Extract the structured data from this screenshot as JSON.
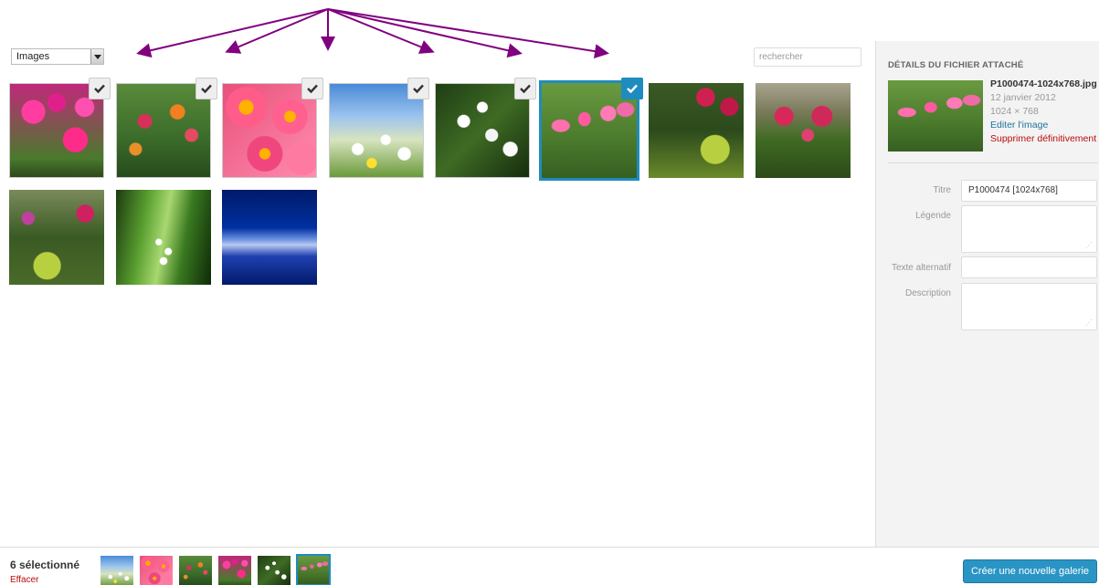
{
  "filter": {
    "selected": "Images"
  },
  "search": {
    "placeholder": "rechercher"
  },
  "grid": {
    "items": [
      {
        "image": "magenta-ranunculus-flowers",
        "selected": true,
        "current": false
      },
      {
        "image": "red-orange-garden-flowers",
        "selected": true,
        "current": false
      },
      {
        "image": "pink-gerbera-flowers",
        "selected": true,
        "current": false
      },
      {
        "image": "daisies-blue-sky",
        "selected": true,
        "current": false
      },
      {
        "image": "white-viburnum-flowers",
        "selected": true,
        "current": false
      },
      {
        "image": "pink-bleeding-heart-flowers",
        "selected": true,
        "current": true
      },
      {
        "image": "red-peony-shrub",
        "selected": false,
        "current": false
      },
      {
        "image": "red-peonies-stone-wall",
        "selected": false,
        "current": false
      },
      {
        "image": "garden-border-flowers",
        "selected": false,
        "current": false
      },
      {
        "image": "lily-of-the-valley",
        "selected": false,
        "current": false
      },
      {
        "image": "blue-hyacinth-field",
        "selected": false,
        "current": false
      }
    ]
  },
  "details": {
    "heading": "DÉTAILS DU FICHIER ATTACHÉ",
    "filename": "P1000474-1024x768.jpg",
    "date": "12 janvier 2012",
    "dimensions": "1024 × 768",
    "edit_link": "Editer l'image",
    "delete_link": "Supprimer définitivement",
    "fields": {
      "title_label": "Titre",
      "title_value": "P1000474 [1024x768]",
      "caption_label": "Légende",
      "caption_value": "",
      "alt_label": "Texte alternatif",
      "alt_value": "",
      "description_label": "Description",
      "description_value": ""
    }
  },
  "selection": {
    "count_text": "6 sélectionné",
    "clear_link": "Effacer",
    "thumbnails": [
      "daisies-blue-sky",
      "pink-gerbera-flowers",
      "red-orange-garden-flowers",
      "magenta-ranunculus-flowers",
      "white-viburnum-flowers",
      "pink-bleeding-heart-flowers"
    ]
  },
  "actions": {
    "create_gallery": "Créer une nouvelle galerie"
  },
  "colors": {
    "accent": "#1e8cbe",
    "arrow": "#800080",
    "delete": "#bc0b0b",
    "link": "#21759b"
  }
}
